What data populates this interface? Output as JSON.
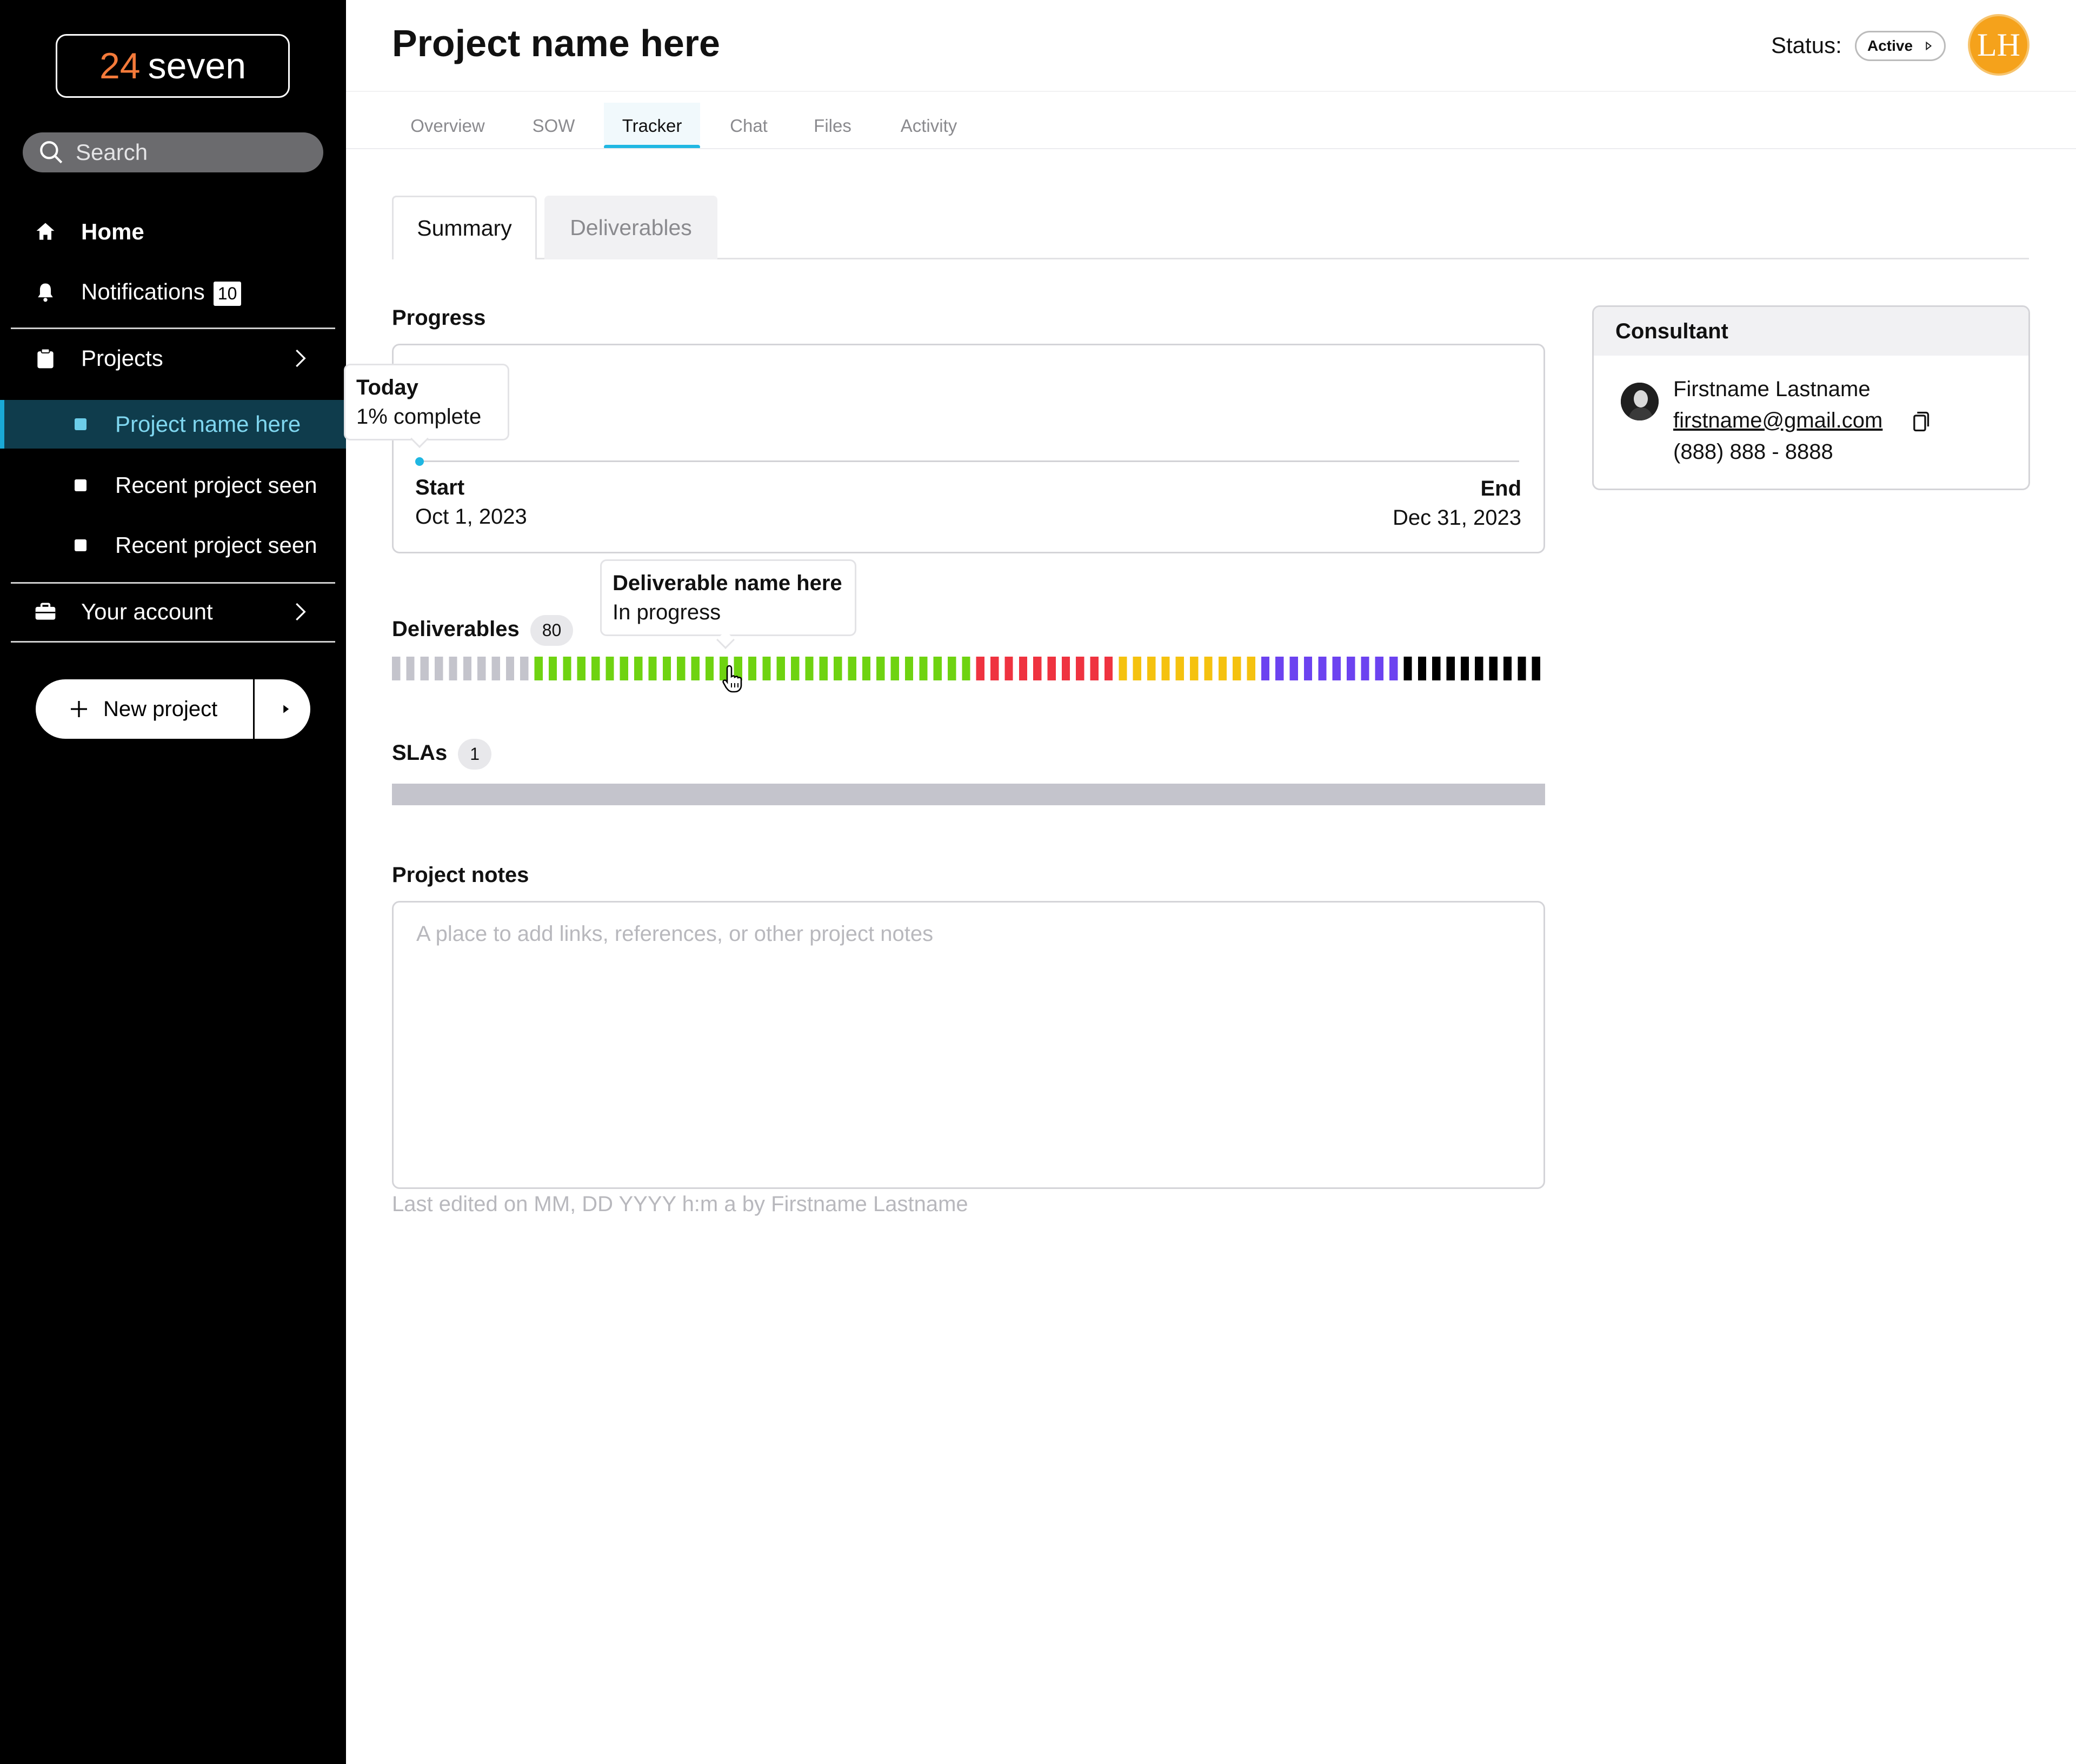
{
  "sidebar": {
    "logo": {
      "number": "24",
      "word": "seven",
      "accent_color": "#f47a3a"
    },
    "search": {
      "placeholder": "Search",
      "icon": "search-icon"
    },
    "items": [
      {
        "label": "Home",
        "icon": "home-icon"
      },
      {
        "label": "Notifications",
        "icon": "bell-icon",
        "badge": "10"
      },
      {
        "label": "Projects",
        "icon": "clipboard-icon"
      },
      {
        "label": "Your account",
        "icon": "briefcase-icon"
      }
    ],
    "projects": [
      {
        "label": "Project name here",
        "active": true
      },
      {
        "label": "Recent project seen",
        "active": false
      },
      {
        "label": "Recent project seen",
        "active": false
      }
    ],
    "new_project_label": "New project"
  },
  "header": {
    "title": "Project name here",
    "status_label": "Status:",
    "status_value": "Active",
    "avatar_initials": "LH",
    "avatar_color": "#f5a21b"
  },
  "tabs": [
    "Overview",
    "SOW",
    "Tracker",
    "Chat",
    "Files",
    "Activity"
  ],
  "active_tab": "Tracker",
  "subtabs": [
    "Summary",
    "Deliverables"
  ],
  "active_subtab": "Summary",
  "progress": {
    "title": "Progress",
    "today_label": "Today",
    "percent_text": "1% complete",
    "percent": 1,
    "start_label": "Start",
    "start_date": "Oct 1, 2023",
    "end_label": "End",
    "end_date": "Dec 31, 2023"
  },
  "deliverables": {
    "title": "Deliverables",
    "count": "80",
    "tooltip_name": "Deliverable name here",
    "tooltip_status": "In progress",
    "segments": [
      {
        "color": "#c4c4cc",
        "count": 10
      },
      {
        "color": "#6fd311",
        "count": 31
      },
      {
        "color": "#ef3340",
        "count": 10
      },
      {
        "color": "#f5c20f",
        "count": 10
      },
      {
        "color": "#6c43f0",
        "count": 10
      },
      {
        "color": "#000000",
        "count": 10
      }
    ]
  },
  "slas": {
    "title": "SLAs",
    "count": "1"
  },
  "notes": {
    "title": "Project notes",
    "placeholder": "A place to add links, references, or other project notes",
    "meta": "Last edited on MM, DD YYYY h:m a by Firstname Lastname"
  },
  "consultant": {
    "title": "Consultant",
    "name": "Firstname Lastname",
    "email": "firstname@gmail.com",
    "phone": "(888) 888 - 8888"
  }
}
